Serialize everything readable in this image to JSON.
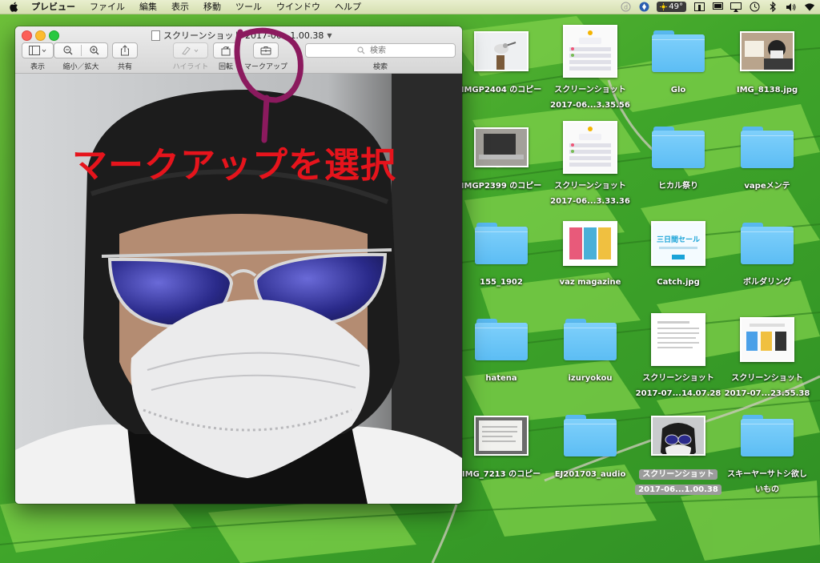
{
  "menubar": {
    "app_name": "プレビュー",
    "menus": [
      "ファイル",
      "編集",
      "表示",
      "移動",
      "ツール",
      "ウインドウ",
      "ヘルプ"
    ],
    "temperature": "49°"
  },
  "window": {
    "title": "スクリーンショット 2017-06...1.00.38",
    "toolbar": {
      "view_label": "表示",
      "zoom_label": "縮小／拡大",
      "share_label": "共有",
      "highlight_label": "ハイライト",
      "rotate_label": "回転",
      "markup_label": "マークアップ",
      "search_label": "検索",
      "search_placeholder": "検索"
    }
  },
  "annotation": {
    "text": "マークアップを選択",
    "color": "#e6141c",
    "circle_color": "#8b1a5e"
  },
  "desktop": {
    "icons": [
      {
        "label": "IMGP2404 のコピー",
        "kind": "photo-bird"
      },
      {
        "label": "スクリーンショット",
        "label2": "2017-06...3.35.56",
        "kind": "screenshot"
      },
      {
        "label": "Glo",
        "kind": "folder"
      },
      {
        "label": "IMG_8138.jpg",
        "kind": "photo-person"
      },
      {
        "label": "IMGP2399 のコピー",
        "kind": "photo-laptop"
      },
      {
        "label": "スクリーンショット",
        "label2": "2017-06...3.33.36",
        "kind": "screenshot"
      },
      {
        "label": "ヒカル祭り",
        "kind": "folder"
      },
      {
        "label": "vapeメンテ",
        "kind": "folder"
      },
      {
        "label": "155_1902",
        "kind": "folder"
      },
      {
        "label": "vaz magazine",
        "kind": "magazine"
      },
      {
        "label": "Catch.jpg",
        "kind": "catch",
        "banner": "三日間セール"
      },
      {
        "label": "ボルダリング",
        "kind": "folder"
      },
      {
        "label": "hatena",
        "kind": "folder"
      },
      {
        "label": "izuryokou",
        "kind": "folder"
      },
      {
        "label": "スクリーンショット",
        "label2": "2017-07...14.07.28",
        "kind": "doc"
      },
      {
        "label": "スクリーンショット",
        "label2": "2017-07...23.55.38",
        "kind": "web"
      },
      {
        "label": "IMG_7213 のコピー",
        "kind": "photo-doc"
      },
      {
        "label": "EJ201703_audio",
        "kind": "folder"
      },
      {
        "label": "スクリーンショット",
        "label2": "2017-06...1.00.38",
        "kind": "photo-selfie",
        "selected": true
      },
      {
        "label": "スキーヤーサトシ欲し",
        "label2": "いもの",
        "kind": "folder"
      }
    ]
  }
}
